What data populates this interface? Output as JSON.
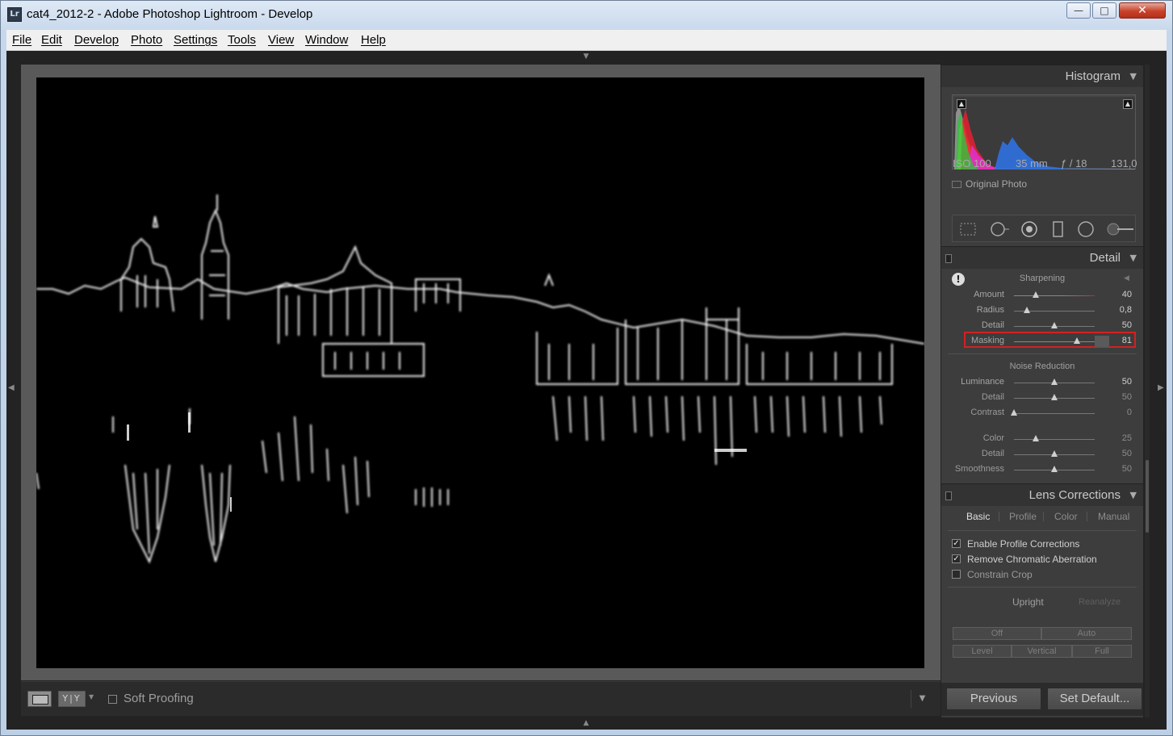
{
  "window": {
    "title": "cat4_2012-2 - Adobe Photoshop Lightroom - Develop",
    "app_icon": "Lr",
    "minimize_icon": "minimize-icon",
    "maximize_icon": "maximize-icon",
    "close_icon": "close-icon"
  },
  "menu": [
    "File",
    "Edit",
    "Develop",
    "Photo",
    "Settings",
    "Tools",
    "View",
    "Window",
    "Help"
  ],
  "toolbar": {
    "view_yy_label": "Y|Y",
    "soft_proofing_label": "Soft Proofing",
    "soft_proofing_checked": false
  },
  "histogram": {
    "title": "Histogram",
    "iso": "ISO 100",
    "focal": "35 mm",
    "aperture": "ƒ / 18",
    "shutter": "131,0",
    "original_photo_label": "Original Photo"
  },
  "detail": {
    "title": "Detail",
    "sharpening_label": "Sharpening",
    "sharpening": [
      {
        "label": "Amount",
        "value": "40",
        "fraction": 0.27
      },
      {
        "label": "Radius",
        "value": "0,8",
        "fraction": 0.16
      },
      {
        "label": "Detail",
        "value": "50",
        "fraction": 0.5
      },
      {
        "label": "Masking",
        "value": "81",
        "fraction": 0.78
      }
    ],
    "noise_label": "Noise Reduction",
    "noise": [
      {
        "label": "Luminance",
        "value": "50",
        "fraction": 0.5
      },
      {
        "label": "Detail",
        "value": "50",
        "fraction": 0.5
      },
      {
        "label": "Contrast",
        "value": "0",
        "fraction": 0.0
      },
      {
        "label": "Color",
        "value": "25",
        "fraction": 0.27
      },
      {
        "label": "Detail",
        "value": "50",
        "fraction": 0.5
      },
      {
        "label": "Smoothness",
        "value": "50",
        "fraction": 0.5
      }
    ]
  },
  "lens": {
    "title": "Lens Corrections",
    "tabs": [
      "Basic",
      "Profile",
      "Color",
      "Manual"
    ],
    "active_tab": "Basic",
    "options": [
      {
        "label": "Enable Profile Corrections",
        "checked": true
      },
      {
        "label": "Remove Chromatic Aberration",
        "checked": true
      },
      {
        "label": "Constrain Crop",
        "checked": false
      }
    ],
    "upright_label": "Upright",
    "reanalyze_label": "Reanalyze",
    "upright_buttons_row1": [
      "Off",
      "Auto"
    ],
    "upright_buttons_row2": [
      "Level",
      "Vertical",
      "Full"
    ]
  },
  "nav": {
    "previous_label": "Previous",
    "set_default_label": "Set Default..."
  },
  "colors": {
    "highlight_border": "#d42020",
    "panel_bg": "#3d3d3d",
    "app_bg": "#232323"
  }
}
